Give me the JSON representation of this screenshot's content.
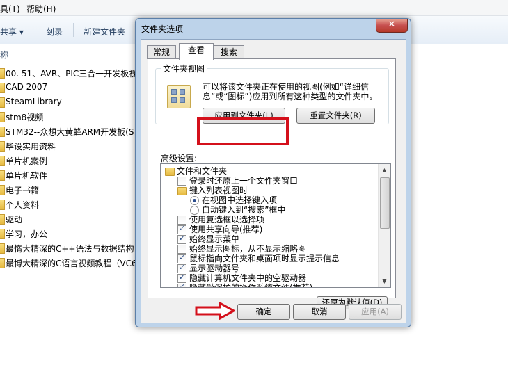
{
  "explorer": {
    "menu": [
      "具(T)",
      "帮助(H)"
    ],
    "toolbar": [
      "共享 ▾",
      "刻录",
      "新建文件夹"
    ],
    "column_header": "称",
    "files": [
      "00. 51、AVR、PIC三合一开发板视",
      "CAD 2007",
      "SteamLibrary",
      "stm8视频",
      "STM32--众想大黄蜂ARM开发板(S",
      "毕设实用资料",
      "单片机案例",
      "单片机软件",
      "电子书籍",
      "个人资料",
      "驱动",
      "学习，办公",
      "最惰大精深的C++语法与数据结构",
      "最博大精深的C语言视频教程（VC6"
    ]
  },
  "dialog": {
    "title": "文件夹选项",
    "close": "✕",
    "tabs": [
      "常规",
      "查看",
      "搜索"
    ],
    "folder_views": {
      "legend": "文件夹视图",
      "description": "可以将该文件夹正在使用的视图(例如“详细信息”或“图标”)应用到所有这种类型的文件夹中。",
      "apply_button": "应用到文件夹(L)",
      "reset_button": "重置文件夹(R)"
    },
    "advanced_label": "高级设置:",
    "advanced_items": [
      {
        "type": "folder",
        "level": 0,
        "label": "文件和文件夹"
      },
      {
        "type": "checkbox",
        "checked": false,
        "level": 1,
        "label": "登录时还原上一个文件夹窗口"
      },
      {
        "type": "folder",
        "level": 1,
        "label": "键入列表视图时"
      },
      {
        "type": "radio",
        "checked": true,
        "level": 2,
        "label": "在视图中选择键入项"
      },
      {
        "type": "radio",
        "checked": false,
        "level": 2,
        "label": "自动键入到“搜索”框中"
      },
      {
        "type": "checkbox",
        "checked": false,
        "level": 1,
        "label": "使用复选框以选择项"
      },
      {
        "type": "checkbox",
        "checked": true,
        "level": 1,
        "label": "使用共享向导(推荐)"
      },
      {
        "type": "checkbox",
        "checked": true,
        "level": 1,
        "label": "始终显示菜单"
      },
      {
        "type": "checkbox",
        "checked": false,
        "level": 1,
        "label": "始终显示图标，从不显示缩略图"
      },
      {
        "type": "checkbox",
        "checked": true,
        "level": 1,
        "label": "鼠标指向文件夹和桌面项时显示提示信息"
      },
      {
        "type": "checkbox",
        "checked": true,
        "level": 1,
        "label": "显示驱动器号"
      },
      {
        "type": "checkbox",
        "checked": true,
        "level": 1,
        "label": "隐藏计算机文件夹中的空驱动器"
      },
      {
        "type": "checkbox",
        "checked": true,
        "level": 1,
        "label": "隐藏受保护的操作系统文件(推荐)"
      }
    ],
    "restore_defaults": "还原为默认值(D)",
    "ok": "确定",
    "cancel": "取消",
    "apply": "应用(A)"
  },
  "colors": {
    "highlight": "#d4101b",
    "dialog_frame": "#bdd3ea"
  }
}
